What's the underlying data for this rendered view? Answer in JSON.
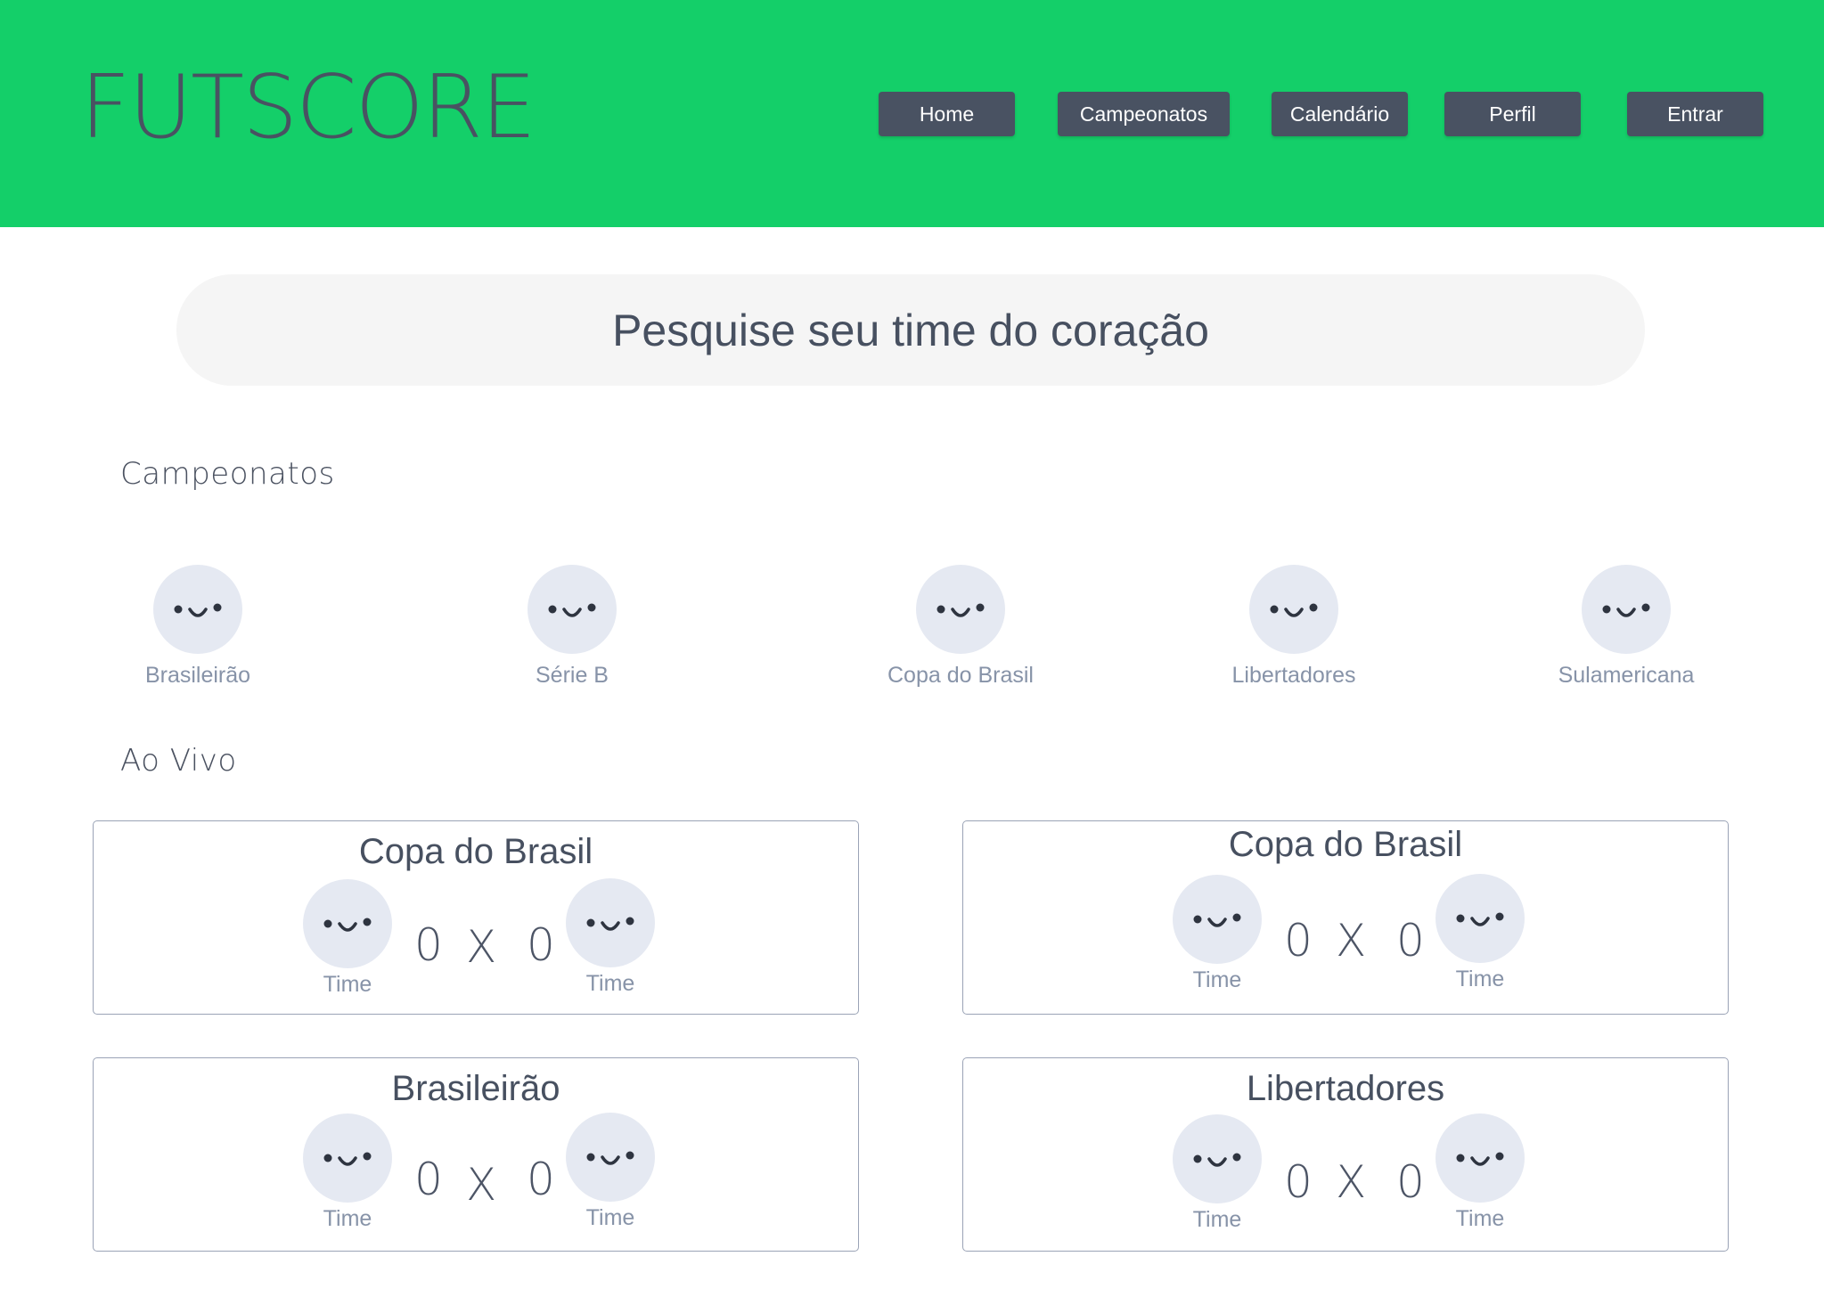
{
  "header": {
    "logo": "FUTSCORE",
    "nav": [
      "Home",
      "Campeonatos",
      "Calendário",
      "Perfil",
      "Entrar"
    ]
  },
  "search": {
    "placeholder": "Pesquise seu time do coração"
  },
  "championships": {
    "title": "Campeonatos",
    "items": [
      "Brasileirão",
      "Série B",
      "Copa do Brasil",
      "Libertadores",
      "Sulamericana"
    ]
  },
  "live": {
    "title": "Ao Vivo",
    "matches": [
      {
        "competition": "Copa do Brasil",
        "home_team": "Time",
        "home_score": "0",
        "separator": "X",
        "away_score": "0",
        "away_team": "Time"
      },
      {
        "competition": "Copa do Brasil",
        "home_team": "Time",
        "home_score": "0",
        "separator": "X",
        "away_score": "0",
        "away_team": "Time"
      },
      {
        "competition": "Brasileirão",
        "home_team": "Time",
        "home_score": "0",
        "separator": "X",
        "away_score": "0",
        "away_team": "Time"
      },
      {
        "competition": "Libertadores",
        "home_team": "Time",
        "home_score": "0",
        "separator": "X",
        "away_score": "0",
        "away_team": "Time"
      }
    ]
  },
  "colors": {
    "header_bg": "#14cf69",
    "button_bg": "#495262",
    "avatar_bg": "#e5e9f2",
    "search_bg": "#f5f5f5"
  },
  "icons": {
    "avatar": "smiley-placeholder-icon"
  }
}
